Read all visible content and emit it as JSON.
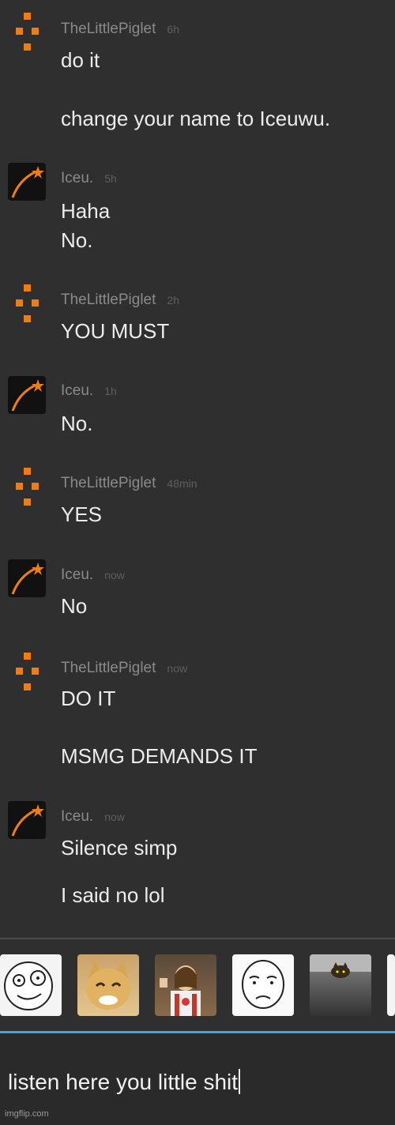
{
  "messages": [
    {
      "user": "TheLittlePiglet",
      "time": "6h",
      "avatar": "piglet",
      "lines": [
        "do it",
        "change your name to Iceuwu."
      ]
    },
    {
      "user": "Iceu.",
      "time": "5h",
      "avatar": "star",
      "lines": [
        "Haha",
        "No."
      ]
    },
    {
      "user": "TheLittlePiglet",
      "time": "2h",
      "avatar": "piglet",
      "lines": [
        "YOU MUST"
      ]
    },
    {
      "user": "Iceu.",
      "time": "1h",
      "avatar": "star",
      "lines": [
        "No."
      ]
    },
    {
      "user": "TheLittlePiglet",
      "time": "48min",
      "avatar": "piglet",
      "lines": [
        "YES"
      ]
    },
    {
      "user": "Iceu.",
      "time": "now",
      "avatar": "star",
      "lines": [
        "No"
      ]
    },
    {
      "user": "TheLittlePiglet",
      "time": "now",
      "avatar": "piglet",
      "lines": [
        "DO IT",
        "MSMG DEMANDS IT"
      ]
    },
    {
      "user": "Iceu.",
      "time": "now",
      "avatar": "star",
      "lines": [
        "Silence simp",
        "I said no lol"
      ]
    }
  ],
  "stickers": [
    "rage-face-sticker",
    "cat-sticker",
    "buddy-christ-sticker",
    "okay-face-sticker",
    "ceiling-cat-sticker",
    "partial-sticker"
  ],
  "composer": {
    "text": "listen here you little shit"
  },
  "watermark": "imgflip.com",
  "colors": {
    "accent": "#3aa7d8",
    "avatar_orange": "#f07d14",
    "background": "#2f2f2f"
  }
}
